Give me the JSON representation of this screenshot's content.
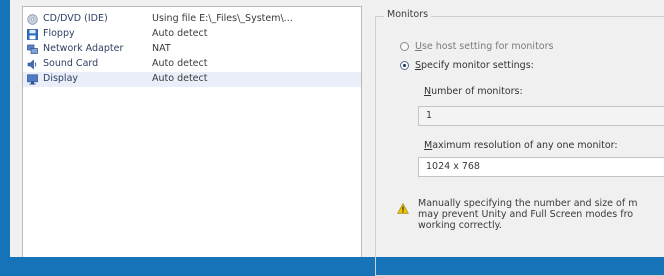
{
  "hardware": [
    {
      "name": "CD/DVD (IDE)",
      "summary": "Using file E:\\_Files\\_System\\...",
      "icon": "cd-dvd-icon",
      "selected": false
    },
    {
      "name": "Floppy",
      "summary": "Auto detect",
      "icon": "floppy-icon",
      "selected": false
    },
    {
      "name": "Network Adapter",
      "summary": "NAT",
      "icon": "network-adapter-icon",
      "selected": false
    },
    {
      "name": "Sound Card",
      "summary": "Auto detect",
      "icon": "sound-card-icon",
      "selected": false
    },
    {
      "name": "Display",
      "summary": "Auto detect",
      "icon": "display-icon",
      "selected": true
    }
  ],
  "monitors": {
    "title": "Monitors",
    "option_host_pre": "",
    "option_host_u": "U",
    "option_host_post": "se host setting for monitors",
    "option_host_checked": false,
    "option_specify_pre": "",
    "option_specify_u": "S",
    "option_specify_post": "pecify monitor settings:",
    "option_specify_checked": true,
    "num_label_pre": "",
    "num_label_u": "N",
    "num_label_post": "umber of monitors:",
    "num_value": "1",
    "res_label_pre": "",
    "res_label_u": "M",
    "res_label_post": "aximum resolution of any one monitor:",
    "res_value": "1024 x 768",
    "warning_text": "Manually specifying the number and size of m\nmay prevent Unity and Full Screen modes fro\nworking correctly."
  },
  "colors": {
    "desktop_background": "#1773b8",
    "selection": "#e9eef8",
    "warning_yellow": "#e8c40c"
  }
}
